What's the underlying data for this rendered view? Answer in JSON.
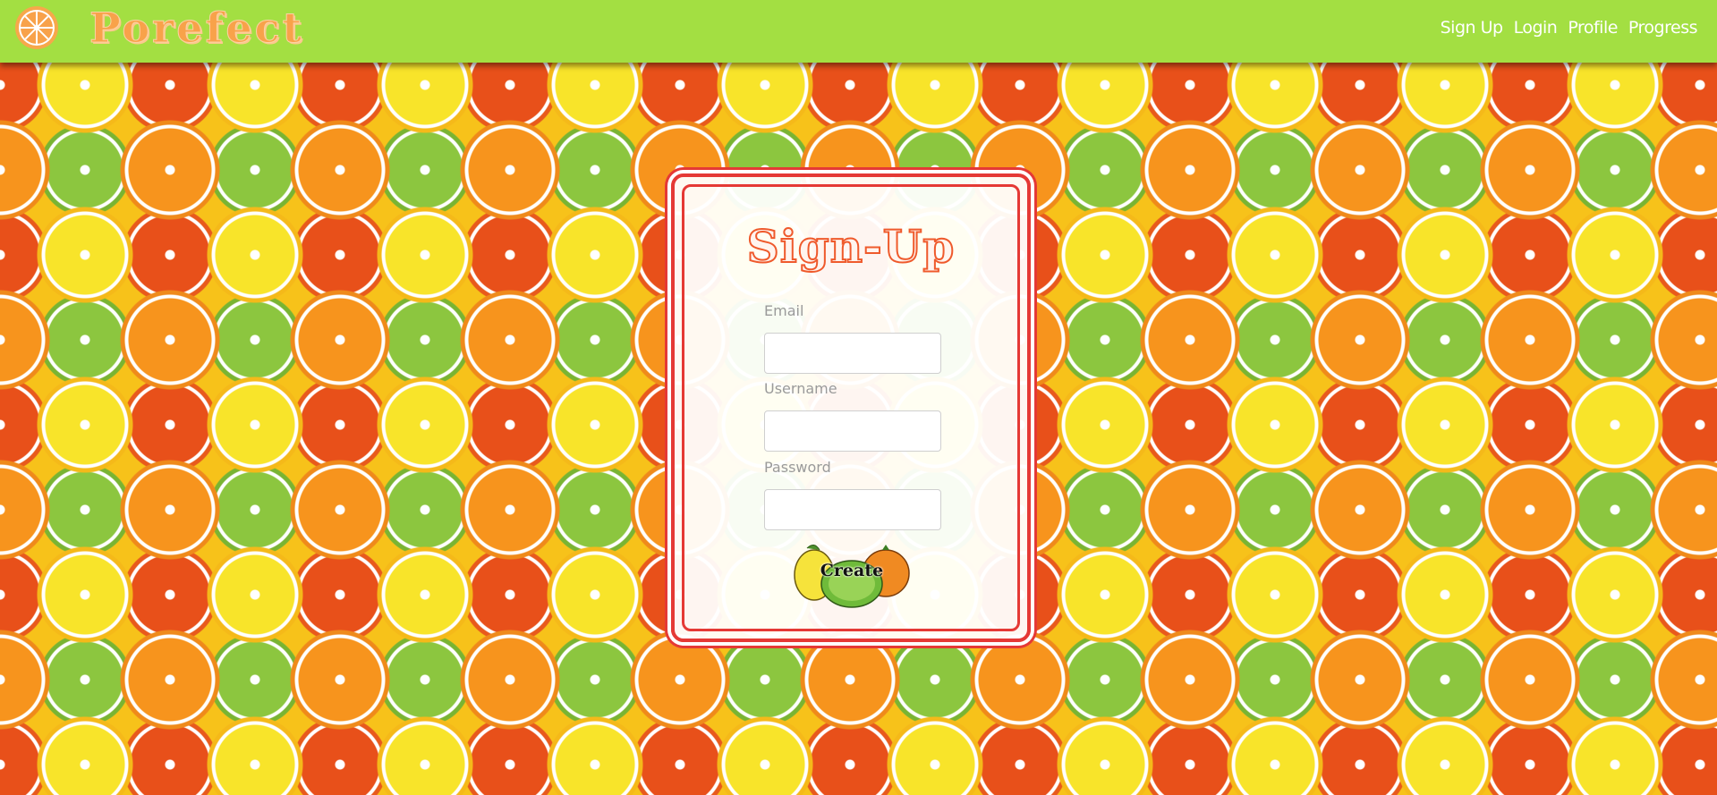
{
  "colors": {
    "navbar": "#a3df42",
    "card_border": "#e53935",
    "brand": "#f8a24a",
    "title_stroke": "#ef5a2c"
  },
  "header": {
    "brand_name": "Porefect",
    "brand_icon": "orange-slice-icon",
    "nav": [
      {
        "label": "Sign Up"
      },
      {
        "label": "Login"
      },
      {
        "label": "Profile"
      },
      {
        "label": "Progress"
      }
    ]
  },
  "form": {
    "title": "Sign-Up",
    "email_label": "Email",
    "email_value": "",
    "username_label": "Username",
    "username_value": "",
    "password_label": "Password",
    "password_value": "",
    "submit_label": "Create",
    "submit_icon": "citrus-fruits-icon"
  }
}
